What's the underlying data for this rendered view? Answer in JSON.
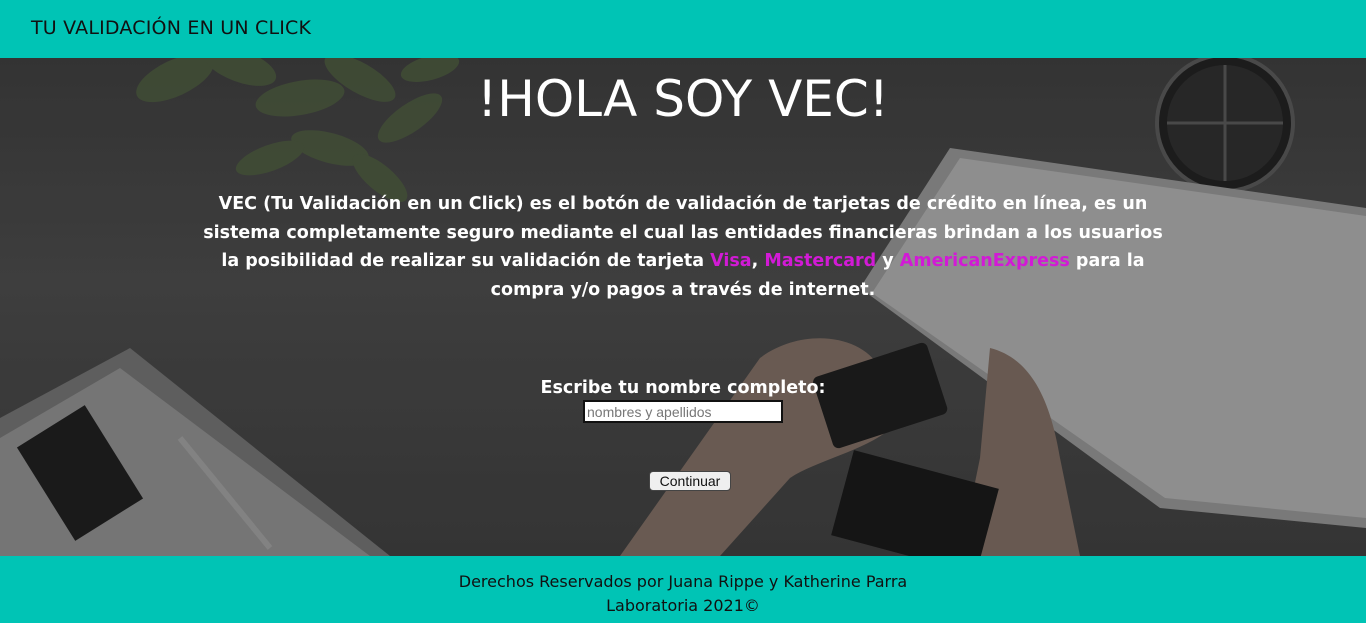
{
  "header": {
    "title": "TU VALIDACIÓN EN UN CLICK"
  },
  "main": {
    "title": "!HOLA SOY VEC!",
    "intro": {
      "text_before": "VEC (Tu Validación en un Click) es el botón de validación de tarjetas de crédito en línea, es un sistema completamente seguro mediante el cual las entidades financieras brindan a los usuarios la posibilidad de realizar su validación de tarjeta ",
      "brand_visa": "Visa",
      "sep_comma": ", ",
      "brand_mastercard": "Mastercard",
      "sep_y": " y ",
      "brand_amex": "AmericanExpress",
      "text_after": " para la compra y/o pagos a través de internet.",
      "brand_color": "#d21ad6"
    },
    "form": {
      "label": "Escribe tu nombre completo:",
      "name_placeholder": "nombres y apellidos",
      "name_value": "",
      "continue_label": "Continuar"
    }
  },
  "footer": {
    "line1": "Derechos Reservados por Juana Rippe y Katherine Parra",
    "line2": "Laboratoria 2021©"
  },
  "colors": {
    "accent": "#00c4b5",
    "text_light": "#ffffff",
    "text_dark": "#111111"
  }
}
